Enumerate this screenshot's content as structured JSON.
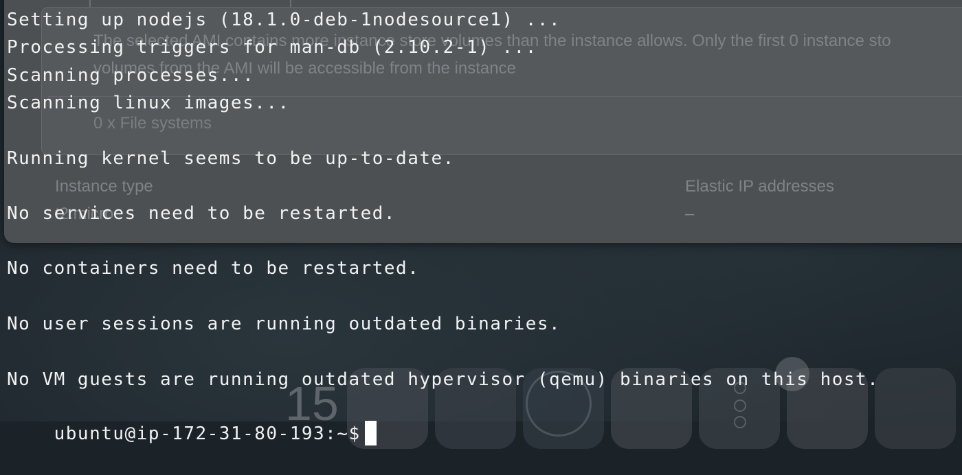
{
  "background": {
    "console_warning_line_1": "The selected AMI contains more instance store volumes than the instance allows. Only the first 0 instance sto",
    "console_warning_line_2": "volumes from the AMI will be accessible from the instance",
    "file_systems": "0 x File systems",
    "instance_type_label": "Instance type",
    "instance_type_value": "t2.micro",
    "elastic_ip_label": "Elastic IP addresses",
    "elastic_ip_value": "–",
    "dock_calendar_day": "15"
  },
  "terminal": {
    "lines": [
      "Setting up nodejs (18.1.0-deb-1nodesource1) ...",
      "Processing triggers for man-db (2.10.2-1) ...",
      "Scanning processes...",
      "Scanning linux images...",
      "",
      "Running kernel seems to be up-to-date.",
      "",
      "No services need to be restarted.",
      "",
      "No containers need to be restarted.",
      "",
      "No user sessions are running outdated binaries.",
      "",
      "No VM guests are running outdated hypervisor (qemu) binaries on this host."
    ],
    "prompt": "ubuntu@ip-172-31-80-193:~$"
  },
  "colors": {
    "terminal_text": "#f2f2f2",
    "terminal_bg": "#1b2329",
    "cursor": "#ffffff"
  }
}
